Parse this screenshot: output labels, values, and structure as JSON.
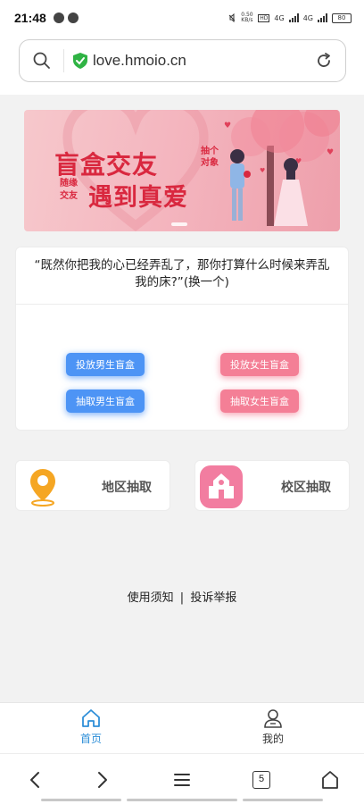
{
  "status_bar": {
    "time": "21:48",
    "speed": "0.50\nKB/s",
    "network": "4G",
    "battery": "80"
  },
  "browser": {
    "url": "love.hmoio.cn"
  },
  "banner": {
    "title_line1": "盲盒交友",
    "title_line2": "遇到真爱",
    "small_text1": "抽个对象",
    "small_text2": "随缘交友"
  },
  "quote": {
    "text": "“既然你把我的心已经弄乱了，那你打算什么时候来弄乱我的床?”",
    "refresh_label": "(换一个)"
  },
  "buttons": {
    "put_male": "投放男生盲盒",
    "get_male": "抽取男生盲盒",
    "put_female": "投放女生盲盒",
    "get_female": "抽取女生盲盒"
  },
  "tiles": {
    "region": "地区抽取",
    "campus": "校区抽取"
  },
  "footer": {
    "terms": "使用须知",
    "separator": "|",
    "report": "投诉举报"
  },
  "tabs": {
    "home": "首页",
    "mine": "我的"
  },
  "nav": {
    "tab_count": "5"
  },
  "colors": {
    "accent_blue": "#4d94f5",
    "accent_pink": "#f47f96",
    "tab_active": "#2f8fd8",
    "banner_red": "#d9283f",
    "location_orange": "#f5a623"
  }
}
